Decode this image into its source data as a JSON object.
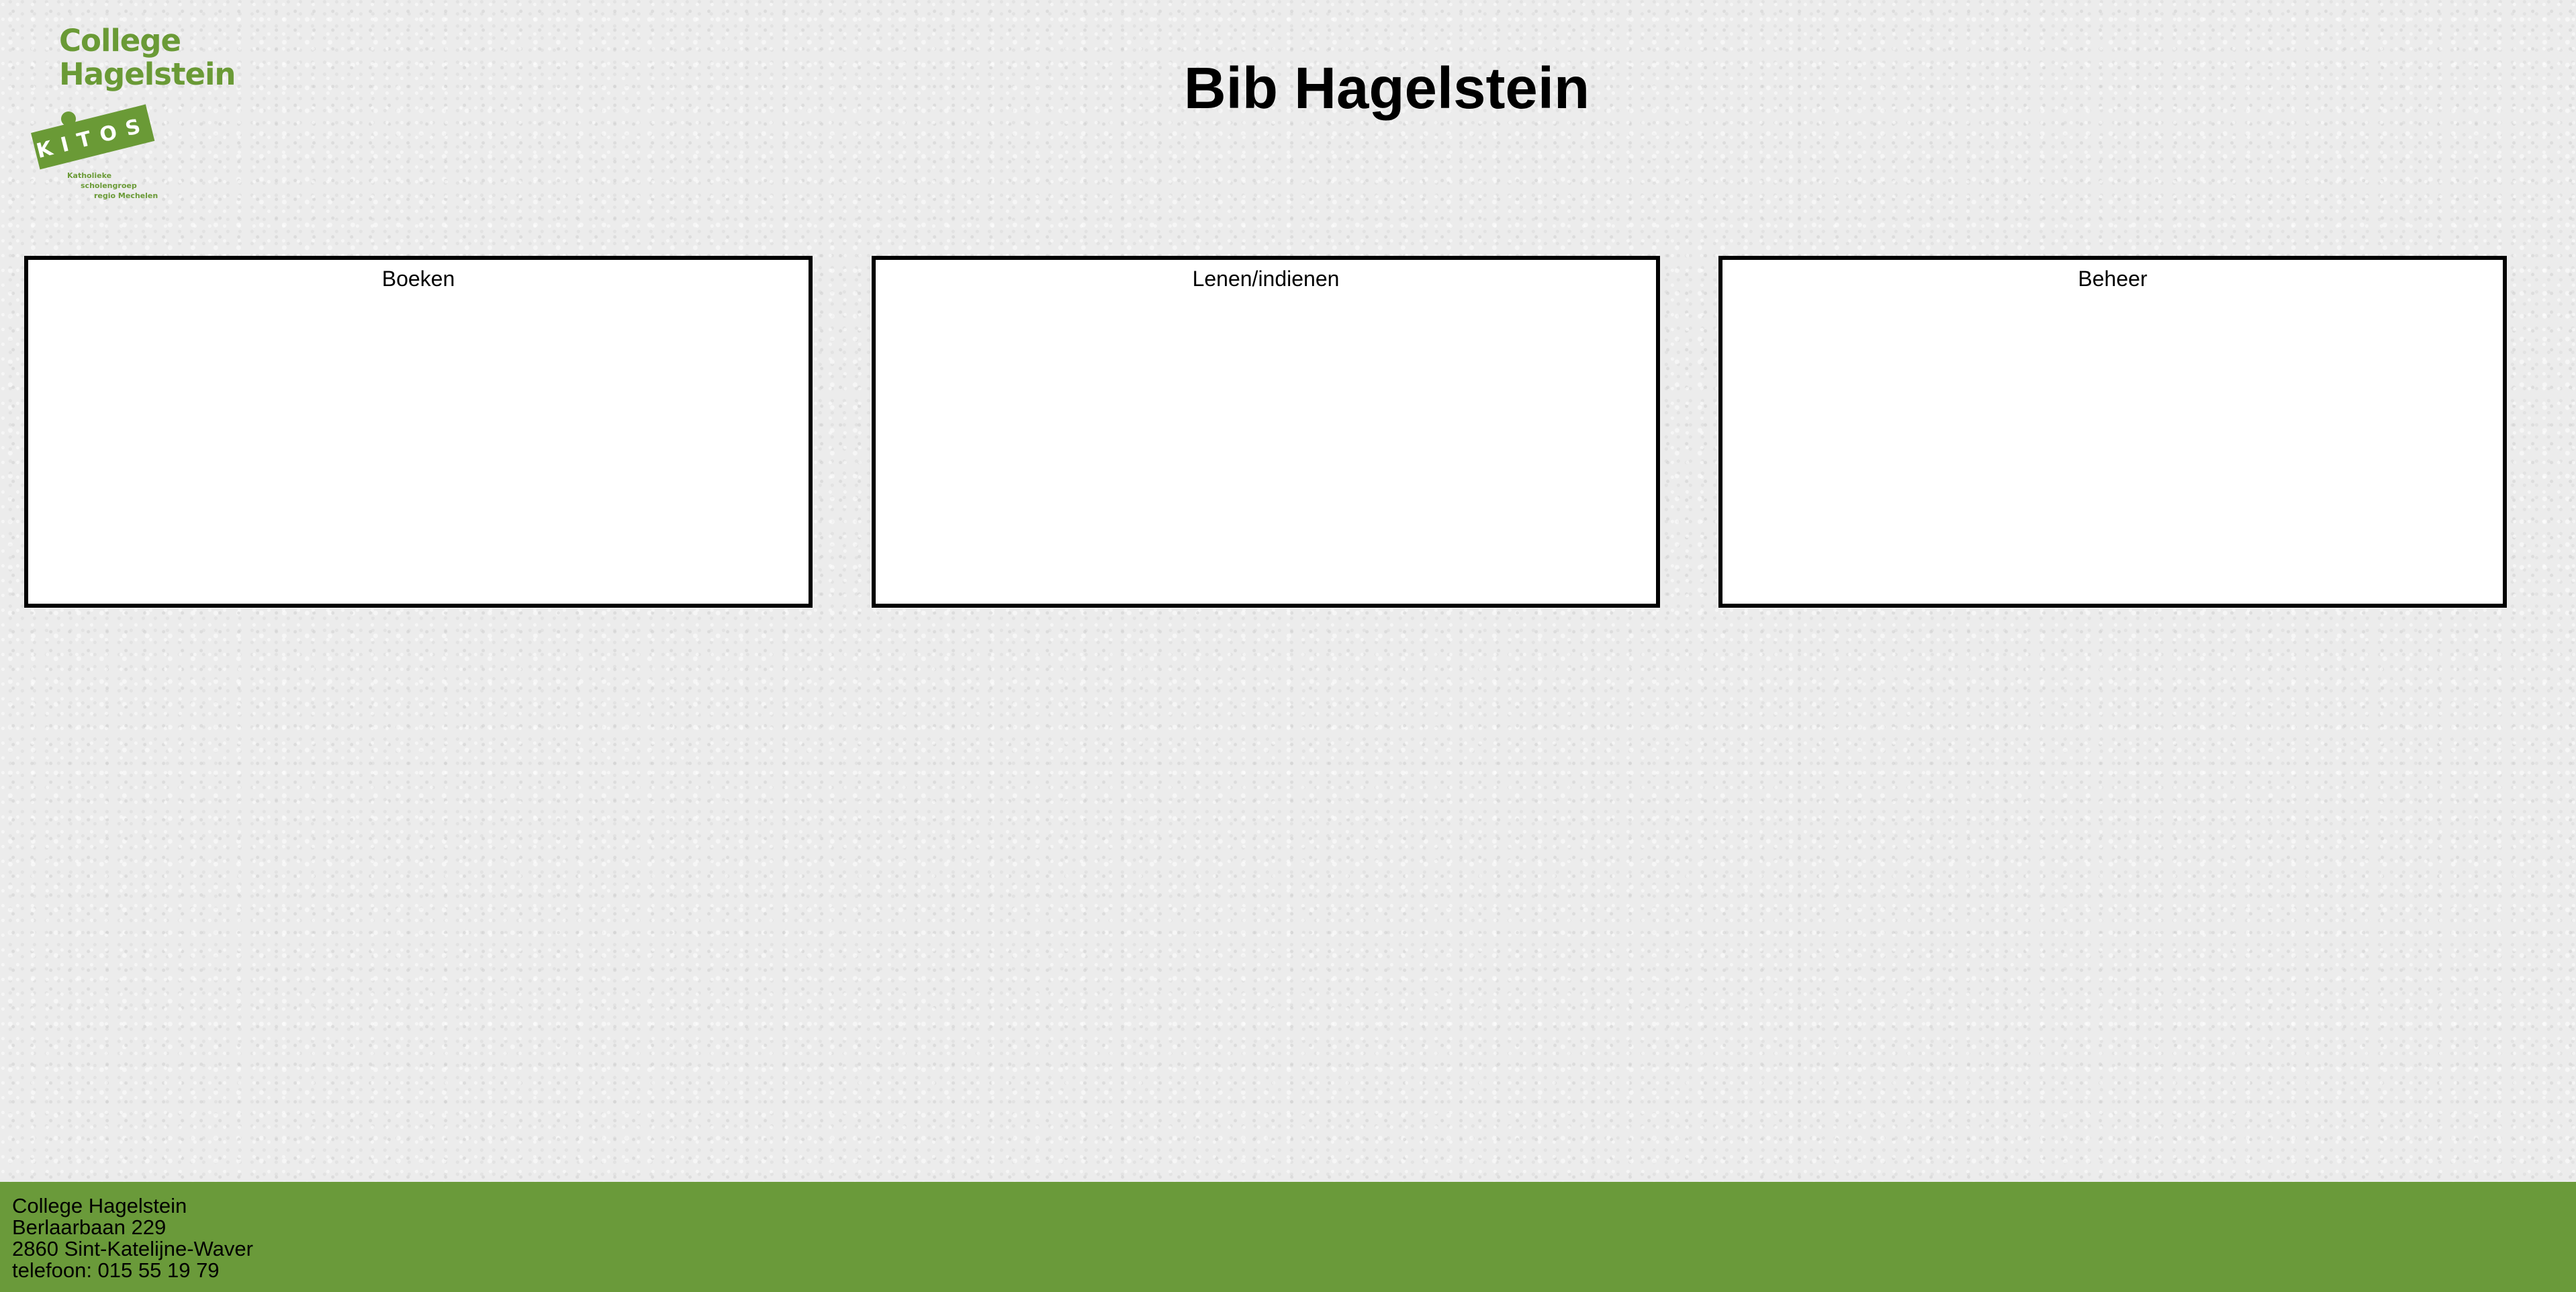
{
  "logo": {
    "line1": "College",
    "line2": "Hagelstein",
    "badge": "KITOS",
    "sub1": "Katholieke",
    "sub2": "scholengroep",
    "sub3": "regio Mechelen"
  },
  "header": {
    "title": "Bib Hagelstein"
  },
  "panels": [
    {
      "title": "Boeken"
    },
    {
      "title": "Lenen/indienen"
    },
    {
      "title": "Beheer"
    }
  ],
  "footer": {
    "name": "College Hagelstein",
    "street": "Berlaarbaan 229",
    "city": "2860 Sint-Katelijne-Waver",
    "phone": "telefoon: 015 55 19 79"
  },
  "colors": {
    "brand_green": "#6a9a36",
    "footer_green": "#6a9a3a",
    "background": "#ececec"
  }
}
